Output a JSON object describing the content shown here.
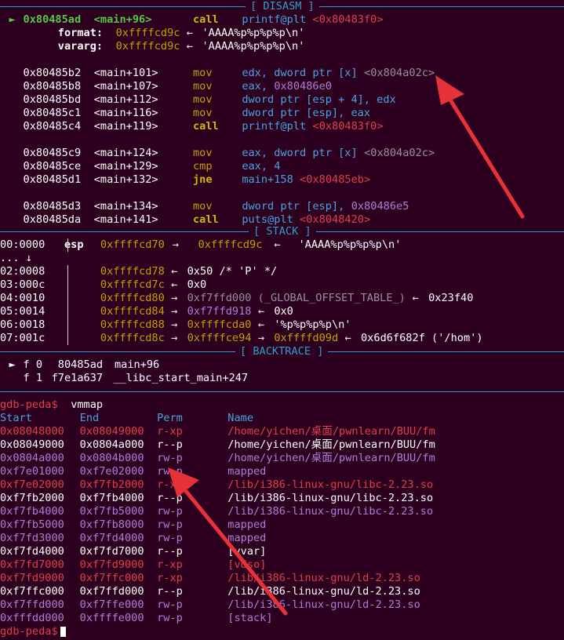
{
  "disasm": {
    "header": "[ DISASM ]",
    "current": {
      "marker": "►",
      "addr": "0x80485ad",
      "sym": "<main+96>",
      "mnem": "call",
      "op": "printf@plt",
      "target": "<0x80483f0>"
    },
    "args": [
      {
        "name": "format:",
        "val": "0xffffcd9c",
        "arrow": "←",
        "str": "'AAAA%p%p%p%p\\n'"
      },
      {
        "name": "vararg:",
        "val": "0xffffcd9c",
        "arrow": "←",
        "str": "'AAAA%p%p%p%p\\n'"
      }
    ],
    "rows": [
      {
        "addr": "0x80485b2",
        "sym": "<main+101>",
        "mnem": "mov",
        "op": "edx, dword ptr [x]",
        "extra": "<0x804a02c>"
      },
      {
        "addr": "0x80485b8",
        "sym": "<main+107>",
        "mnem": "mov",
        "op": "eax, ",
        "imm": "0x80486e0"
      },
      {
        "addr": "0x80485bd",
        "sym": "<main+112>",
        "mnem": "mov",
        "op": "dword ptr [esp + 4], edx"
      },
      {
        "addr": "0x80485c1",
        "sym": "<main+116>",
        "mnem": "mov",
        "op": "dword ptr [esp], eax"
      },
      {
        "addr": "0x80485c4",
        "sym": "<main+119>",
        "mnem": "call",
        "op": "printf@plt",
        "target": "<0x80483f0>"
      },
      {
        "addr": "0x80485c9",
        "sym": "<main+124>",
        "mnem": "mov",
        "op": "eax, dword ptr [x]",
        "extra": "<0x804a02c>"
      },
      {
        "addr": "0x80485ce",
        "sym": "<main+129>",
        "mnem": "cmp",
        "op": "eax, 4"
      },
      {
        "addr": "0x80485d1",
        "sym": "<main+132>",
        "mnem": "jne",
        "op": "main+158",
        "target": "<0x80485eb>"
      },
      {
        "addr": "0x80485d3",
        "sym": "<main+134>",
        "mnem": "mov",
        "op": "dword ptr [esp], ",
        "imm": "0x80486e5"
      },
      {
        "addr": "0x80485da",
        "sym": "<main+141>",
        "mnem": "call",
        "op": "puts@plt",
        "target": "<0x8048420>"
      }
    ]
  },
  "stack": {
    "header": "[ STACK ]",
    "rows": [
      {
        "off": "00:0000",
        "reg": "esp",
        "addr": "0x ffffcd70",
        "raw": "0xffffcd70 —▸ 0xffffcd9c ◂— 'AAAA%p%p%p%p\\n'"
      },
      {
        "off": "... ↓"
      },
      {
        "off": "02:0008"
      },
      {
        "off": "03:000c"
      },
      {
        "off": "04:0010"
      },
      {
        "off": "05:0014"
      },
      {
        "off": "06:0018"
      },
      {
        "off": "07:001c"
      }
    ],
    "lines": {
      "l0_a": "0xffffcd70",
      "l0_b": "0xffffcd9c",
      "l0_c": "'AAAA%p%p%p%p\\n'",
      "l2_a": "0xffffcd78",
      "l2_b": "0x50 /* 'P' */",
      "l3_a": "0xffffcd7c",
      "l3_b": "0x0",
      "l4_a": "0xffffcd80",
      "l4_b": "0xf7ffd000 (_GLOBAL_OFFSET_TABLE_)",
      "l4_c": "0x23f40",
      "l5_a": "0xffffcd84",
      "l5_b": "0xf7ffd918",
      "l5_c": "0x0",
      "l6_a": "0xffffcd88",
      "l6_b": "0xffffcda0",
      "l6_c": "'%p%p%p%p\\n'",
      "l7_a": "0xffffcd8c",
      "l7_b": "0xffffce94",
      "l7_c": "0xffffd09d",
      "l7_d": "0x6d6f682f ('/hom')",
      "ellipsis": "... ↓",
      "arrow_r": "→",
      "arrow_l": "←"
    }
  },
  "backtrace": {
    "header": "[ BACKTRACE ]",
    "f0": {
      "marker": "►",
      "label": "f 0",
      "addr": "80485ad",
      "fn": "main+96"
    },
    "f1": {
      "label": "f 1",
      "addr": "f7e1a637",
      "fn": "__libc_start_main+247"
    }
  },
  "vmmap": {
    "prompt": "gdb-peda$",
    "cmd": "vmmap",
    "headers": {
      "start": "Start",
      "end": "End",
      "perm": "Perm",
      "name": "Name"
    },
    "rows": [
      {
        "start": "0x08048000",
        "end": "0x08049000",
        "perm": "r-xp",
        "name": "/home/yichen/桌面/pwnlearn/BUU/fm"
      },
      {
        "start": "0x08049000",
        "end": "0x0804a000",
        "perm": "r--p",
        "name": "/home/yichen/桌面/pwnlearn/BUU/fm"
      },
      {
        "start": "0x0804a000",
        "end": "0x0804b000",
        "perm": "rw-p",
        "name": "/home/yichen/桌面/pwnlearn/BUU/fm"
      },
      {
        "start": "0xf7e01000",
        "end": "0xf7e02000",
        "perm": "rw-p",
        "name": "mapped"
      },
      {
        "start": "0xf7e02000",
        "end": "0xf7fb2000",
        "perm": "r-xp",
        "name": "/lib/i386-linux-gnu/libc-2.23.so"
      },
      {
        "start": "0xf7fb2000",
        "end": "0xf7fb4000",
        "perm": "r--p",
        "name": "/lib/i386-linux-gnu/libc-2.23.so"
      },
      {
        "start": "0xf7fb4000",
        "end": "0xf7fb5000",
        "perm": "rw-p",
        "name": "/lib/i386-linux-gnu/libc-2.23.so"
      },
      {
        "start": "0xf7fb5000",
        "end": "0xf7fb8000",
        "perm": "rw-p",
        "name": "mapped"
      },
      {
        "start": "0xf7fd3000",
        "end": "0xf7fd4000",
        "perm": "rw-p",
        "name": "mapped"
      },
      {
        "start": "0xf7fd4000",
        "end": "0xf7fd7000",
        "perm": "r--p",
        "name": "[vvar]"
      },
      {
        "start": "0xf7fd7000",
        "end": "0xf7fd9000",
        "perm": "r-xp",
        "name": "[vdso]"
      },
      {
        "start": "0xf7fd9000",
        "end": "0xf7ffc000",
        "perm": "r-xp",
        "name": "/lib/i386-linux-gnu/ld-2.23.so"
      },
      {
        "start": "0xf7ffc000",
        "end": "0xf7ffd000",
        "perm": "r--p",
        "name": "/lib/i386-linux-gnu/ld-2.23.so"
      },
      {
        "start": "0xf7ffd000",
        "end": "0xf7ffe000",
        "perm": "rw-p",
        "name": "/lib/i386-linux-gnu/ld-2.23.so"
      },
      {
        "start": "0xfffdd000",
        "end": "0xffffe000",
        "perm": "rw-p",
        "name": "[stack]"
      }
    ],
    "final_prompt": "gdb-peda$"
  },
  "colors": {
    "background": "#2c001e",
    "separator": "#2fa0c8",
    "annotation_arrow": "#e8323a"
  }
}
